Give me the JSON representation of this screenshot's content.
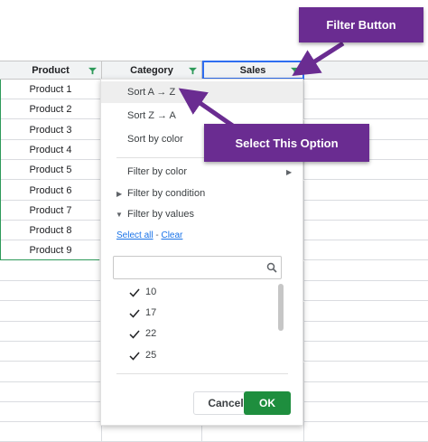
{
  "sheet": {
    "headers": [
      "Product",
      "Category",
      "Sales"
    ],
    "rows": [
      "Product 1",
      "Product 2",
      "Product 3",
      "Product 4",
      "Product 5",
      "Product 6",
      "Product 7",
      "Product 8",
      "Product 9"
    ]
  },
  "filter_menu": {
    "sort_az": "Sort A → Z",
    "sort_za": "Sort Z → A",
    "sort_color": "Sort by color",
    "filter_color": "Filter by color",
    "filter_condition": "Filter by condition",
    "filter_values": "Filter by values",
    "select_all": "Select all",
    "link_sep": "-",
    "clear": "Clear",
    "search_value": "",
    "values": [
      "10",
      "17",
      "22",
      "25"
    ],
    "cancel": "Cancel",
    "ok": "OK"
  },
  "callouts": {
    "filter_button": "Filter Button",
    "select_option": "Select This Option"
  },
  "colors": {
    "callout": "#6a2c91",
    "ok_button": "#1e8e3e",
    "link": "#1a73e8",
    "selection_border": "#2e9a5a"
  }
}
